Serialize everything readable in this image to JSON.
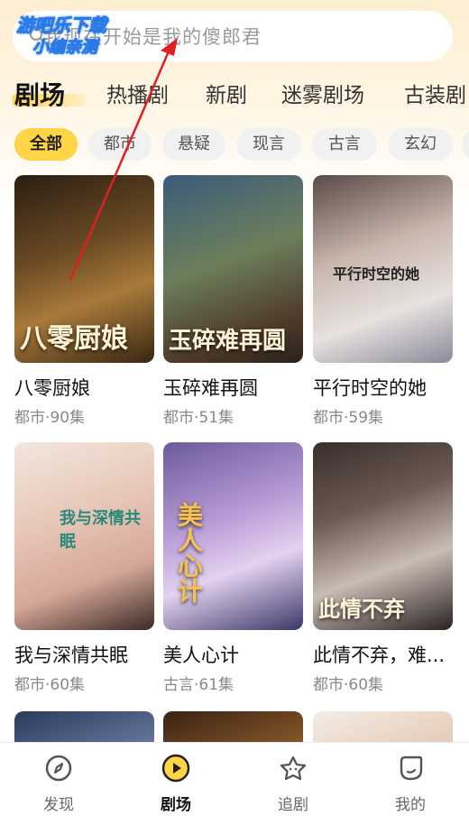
{
  "watermark": {
    "line1": "游吧乐下载",
    "line2": "小编亲测"
  },
  "search": {
    "placeholder": "我现在开始是我的傻郎君"
  },
  "tabs": [
    {
      "label": "剧场"
    },
    {
      "label": "热播剧"
    },
    {
      "label": "新剧"
    },
    {
      "label": "迷雾剧场"
    },
    {
      "label": "古装剧"
    }
  ],
  "chips": [
    {
      "label": "全部"
    },
    {
      "label": "都市"
    },
    {
      "label": "悬疑"
    },
    {
      "label": "现言"
    },
    {
      "label": "古言"
    },
    {
      "label": "玄幻"
    }
  ],
  "cards": [
    {
      "title": "八零厨娘",
      "meta": "都市·90集",
      "poster_text": "八零厨娘"
    },
    {
      "title": "玉碎难再圆",
      "meta": "都市·51集",
      "poster_text": "玉碎难再圆"
    },
    {
      "title": "平行时空的她",
      "meta": "都市·59集",
      "poster_text": "平行时空的她"
    },
    {
      "title": "我与深情共眠",
      "meta": "都市·60集",
      "poster_text": "我与深情共眠"
    },
    {
      "title": "美人心计",
      "meta": "古言·61集",
      "poster_text": "美人心计"
    },
    {
      "title": "此情不弃，难...",
      "meta": "都市·60集",
      "poster_text": "此情不弃"
    }
  ],
  "nav": [
    {
      "label": "发现",
      "icon": "compass-icon"
    },
    {
      "label": "剧场",
      "icon": "play-icon"
    },
    {
      "label": "追剧",
      "icon": "star-icon"
    },
    {
      "label": "我的",
      "icon": "profile-icon"
    }
  ],
  "colors": {
    "accent": "#ffd447",
    "annotation_arrow": "#e02020"
  }
}
